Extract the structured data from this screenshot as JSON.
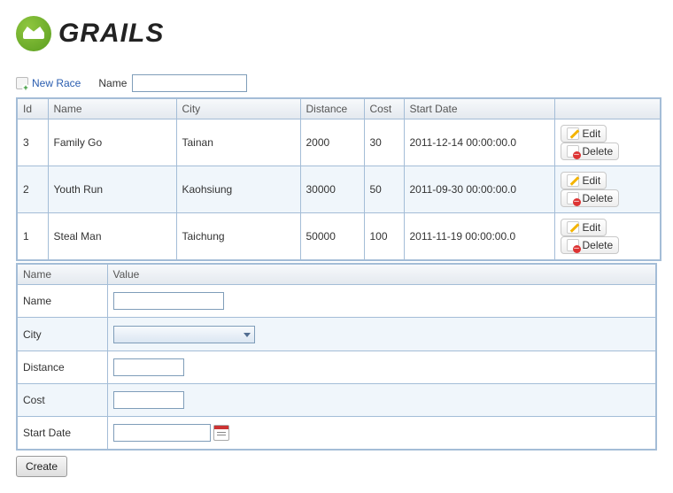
{
  "brand": "GRAILS",
  "toolbar": {
    "new_race_label": "New Race",
    "filter_label": "Name"
  },
  "grid": {
    "headers": {
      "id": "Id",
      "name": "Name",
      "city": "City",
      "distance": "Distance",
      "cost": "Cost",
      "start_date": "Start Date"
    },
    "rows": [
      {
        "id": "3",
        "name": "Family Go",
        "city": "Tainan",
        "distance": "2000",
        "cost": "30",
        "start_date": "2011-12-14 00:00:00.0"
      },
      {
        "id": "2",
        "name": "Youth Run",
        "city": "Kaohsiung",
        "distance": "30000",
        "cost": "50",
        "start_date": "2011-09-30 00:00:00.0"
      },
      {
        "id": "1",
        "name": "Steal Man",
        "city": "Taichung",
        "distance": "50000",
        "cost": "100",
        "start_date": "2011-11-19 00:00:00.0"
      }
    ],
    "actions": {
      "edit": "Edit",
      "delete": "Delete"
    }
  },
  "form": {
    "headers": {
      "name": "Name",
      "value": "Value"
    },
    "fields": {
      "name": {
        "label": "Name",
        "value": ""
      },
      "city": {
        "label": "City",
        "value": ""
      },
      "distance": {
        "label": "Distance",
        "value": ""
      },
      "cost": {
        "label": "Cost",
        "value": ""
      },
      "start_date": {
        "label": "Start Date",
        "value": ""
      }
    },
    "submit_label": "Create"
  }
}
